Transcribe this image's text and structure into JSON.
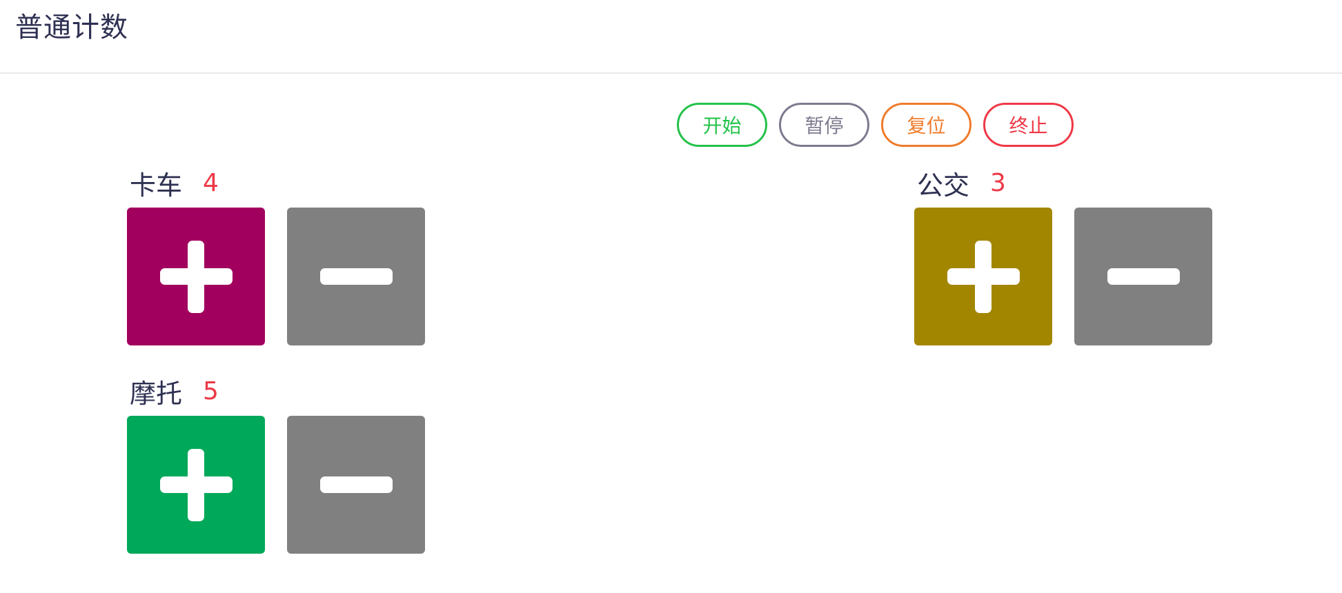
{
  "page": {
    "title": "普通计数"
  },
  "controls": [
    {
      "label": "开始",
      "color": "#23c24a"
    },
    {
      "label": "暂停",
      "color": "#7c7a8e"
    },
    {
      "label": "复位",
      "color": "#f07b2b"
    },
    {
      "label": "终止",
      "color": "#ee3846"
    }
  ],
  "counters": [
    {
      "name": "卡车",
      "value": "4",
      "plus_color": "#a2005e",
      "minus_color": "#808080"
    },
    {
      "name": "公交",
      "value": "3",
      "plus_color": "#a38600",
      "minus_color": "#808080"
    },
    {
      "name": "摩托",
      "value": "5",
      "plus_color": "#00a85a",
      "minus_color": "#808080"
    }
  ],
  "icons": {
    "plus": "plus-icon",
    "minus": "minus-icon"
  },
  "theme": {
    "value_color": "#ee3846",
    "title_color": "#2e3052"
  }
}
